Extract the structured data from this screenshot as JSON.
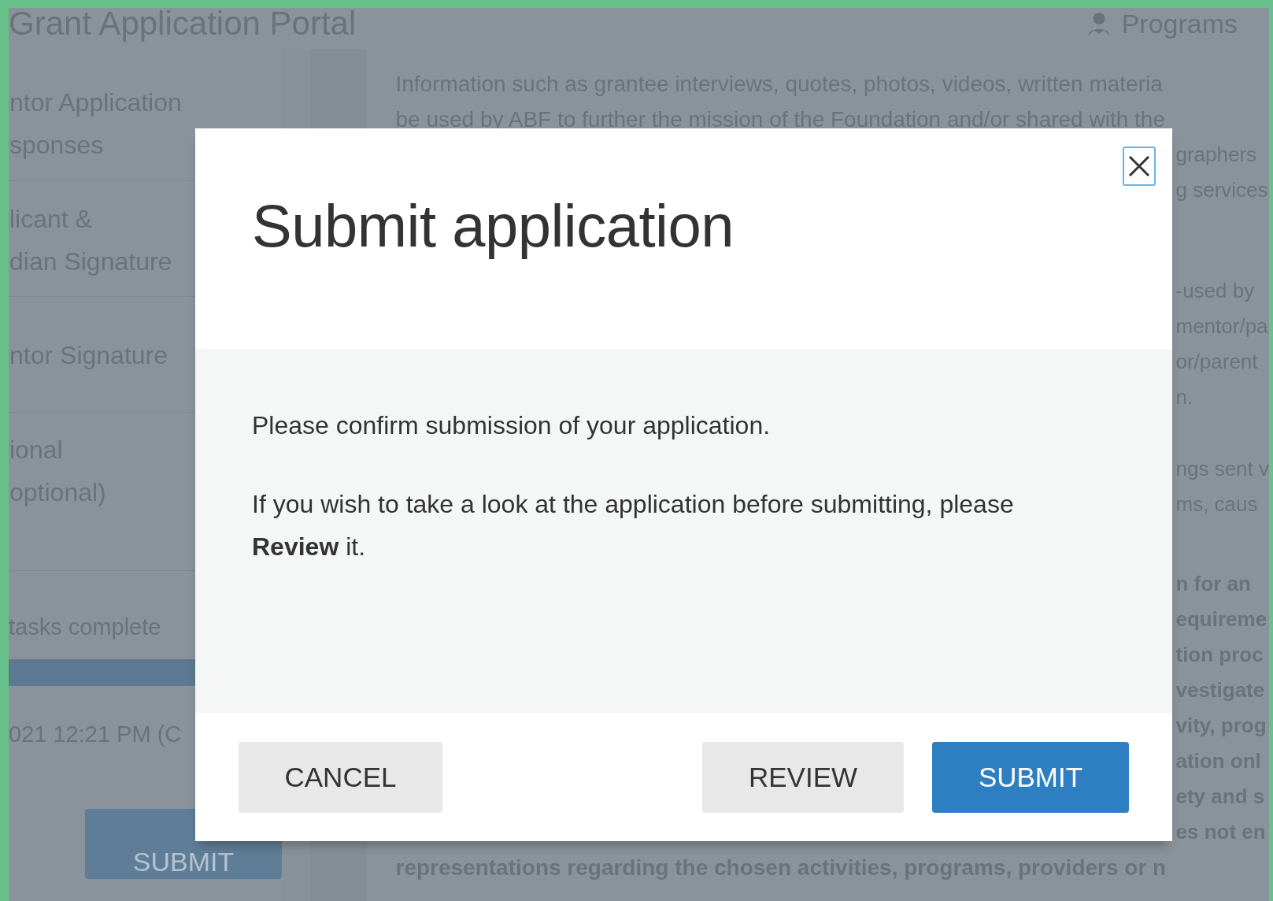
{
  "header": {
    "title": "Grant Application Portal",
    "menu_label": "Programs"
  },
  "sidebar": {
    "items": [
      {
        "lines": [
          "ntor Application",
          "sponses"
        ]
      },
      {
        "lines": [
          "licant &",
          "dian Signature"
        ]
      },
      {
        "lines": [
          "ntor Signature"
        ]
      },
      {
        "lines": [
          "ional",
          "optional)"
        ]
      }
    ],
    "progress": {
      "label": "tasks complete",
      "level": 1
    },
    "saved_text": "021 12:21 PM (C",
    "submit_label": "SUBMIT"
  },
  "content": {
    "paragraphs": [
      {
        "bold": false,
        "lines": [
          {
            "text": "Information such as grantee interviews, quotes, photos, videos, written materia",
            "kind": "full"
          },
          {
            "text": "be used by ABF to further the mission of the Foundation and/or shared with the",
            "kind": "full"
          },
          {
            "text": "graphers",
            "kind": "fragment"
          },
          {
            "text": "g services",
            "kind": "fragment"
          }
        ]
      },
      {
        "bold": false,
        "lines": [
          {
            "text": "-used by",
            "kind": "fragment"
          },
          {
            "text": "mentor/pa",
            "kind": "fragment"
          },
          {
            "text": "or/parent",
            "kind": "fragment"
          },
          {
            "text": "n.",
            "kind": "fragment"
          }
        ]
      },
      {
        "bold": false,
        "lines": [
          {
            "text": "ngs sent v",
            "kind": "fragment"
          },
          {
            "text": "ms, caus",
            "kind": "fragment"
          }
        ]
      },
      {
        "bold": true,
        "lines": [
          {
            "text": "n for an",
            "kind": "fragment"
          },
          {
            "text": "equireme",
            "kind": "fragment"
          },
          {
            "text": "tion proc",
            "kind": "fragment"
          },
          {
            "text": "vestigate",
            "kind": "fragment"
          },
          {
            "text": "vity, prog",
            "kind": "fragment"
          },
          {
            "text": "ation onl",
            "kind": "fragment"
          },
          {
            "text": "ety and s",
            "kind": "fragment"
          },
          {
            "text": "es not en",
            "kind": "fragment"
          },
          {
            "text": "representations regarding the chosen activities, programs, providers or n",
            "kind": "full"
          }
        ]
      }
    ]
  },
  "dialog": {
    "title": "Submit application",
    "messages": [
      "Please confirm submission of your application.",
      "If you wish to take a look at the application before submitting, please **Review** it."
    ],
    "buttons": [
      {
        "label": "CANCEL",
        "kind": "secondary"
      },
      {
        "label": "REVIEW",
        "kind": "secondary"
      },
      {
        "label": "SUBMIT",
        "kind": "primary"
      }
    ]
  }
}
